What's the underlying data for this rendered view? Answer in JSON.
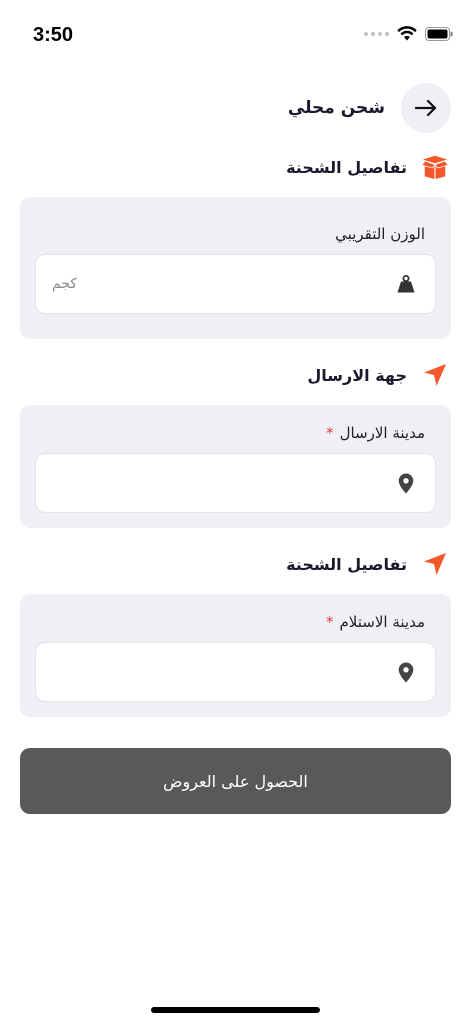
{
  "status_bar": {
    "time": "3:50",
    "icons": [
      "signal-dots-icon",
      "wifi-icon",
      "battery-icon"
    ]
  },
  "header": {
    "title": "شحن محلي",
    "back_icon": "arrow-right-icon"
  },
  "shipment_details": {
    "title": "تفاصيل الشحنة",
    "icon": "open-box-icon",
    "weight_label": "الوزن التقريبي",
    "weight_placeholder": "كجم",
    "weight_icon": "weight-icon"
  },
  "sender": {
    "title": "جهة الارسال",
    "icon": "navigation-arrow-icon",
    "city_label": "مدينة الارسال",
    "required_mark": "*",
    "city_icon": "location-pin-icon"
  },
  "receiver": {
    "title": "تفاصيل الشحنة",
    "icon": "navigation-arrow-icon",
    "city_label": "مدينة الاستلام",
    "required_mark": "*",
    "city_icon": "location-pin-icon"
  },
  "submit": {
    "label": "الحصول على العروض"
  },
  "colors": {
    "accent": "#f4582a",
    "card_bg": "#eff0f6",
    "button_bg": "#595959",
    "required": "#e53935"
  }
}
